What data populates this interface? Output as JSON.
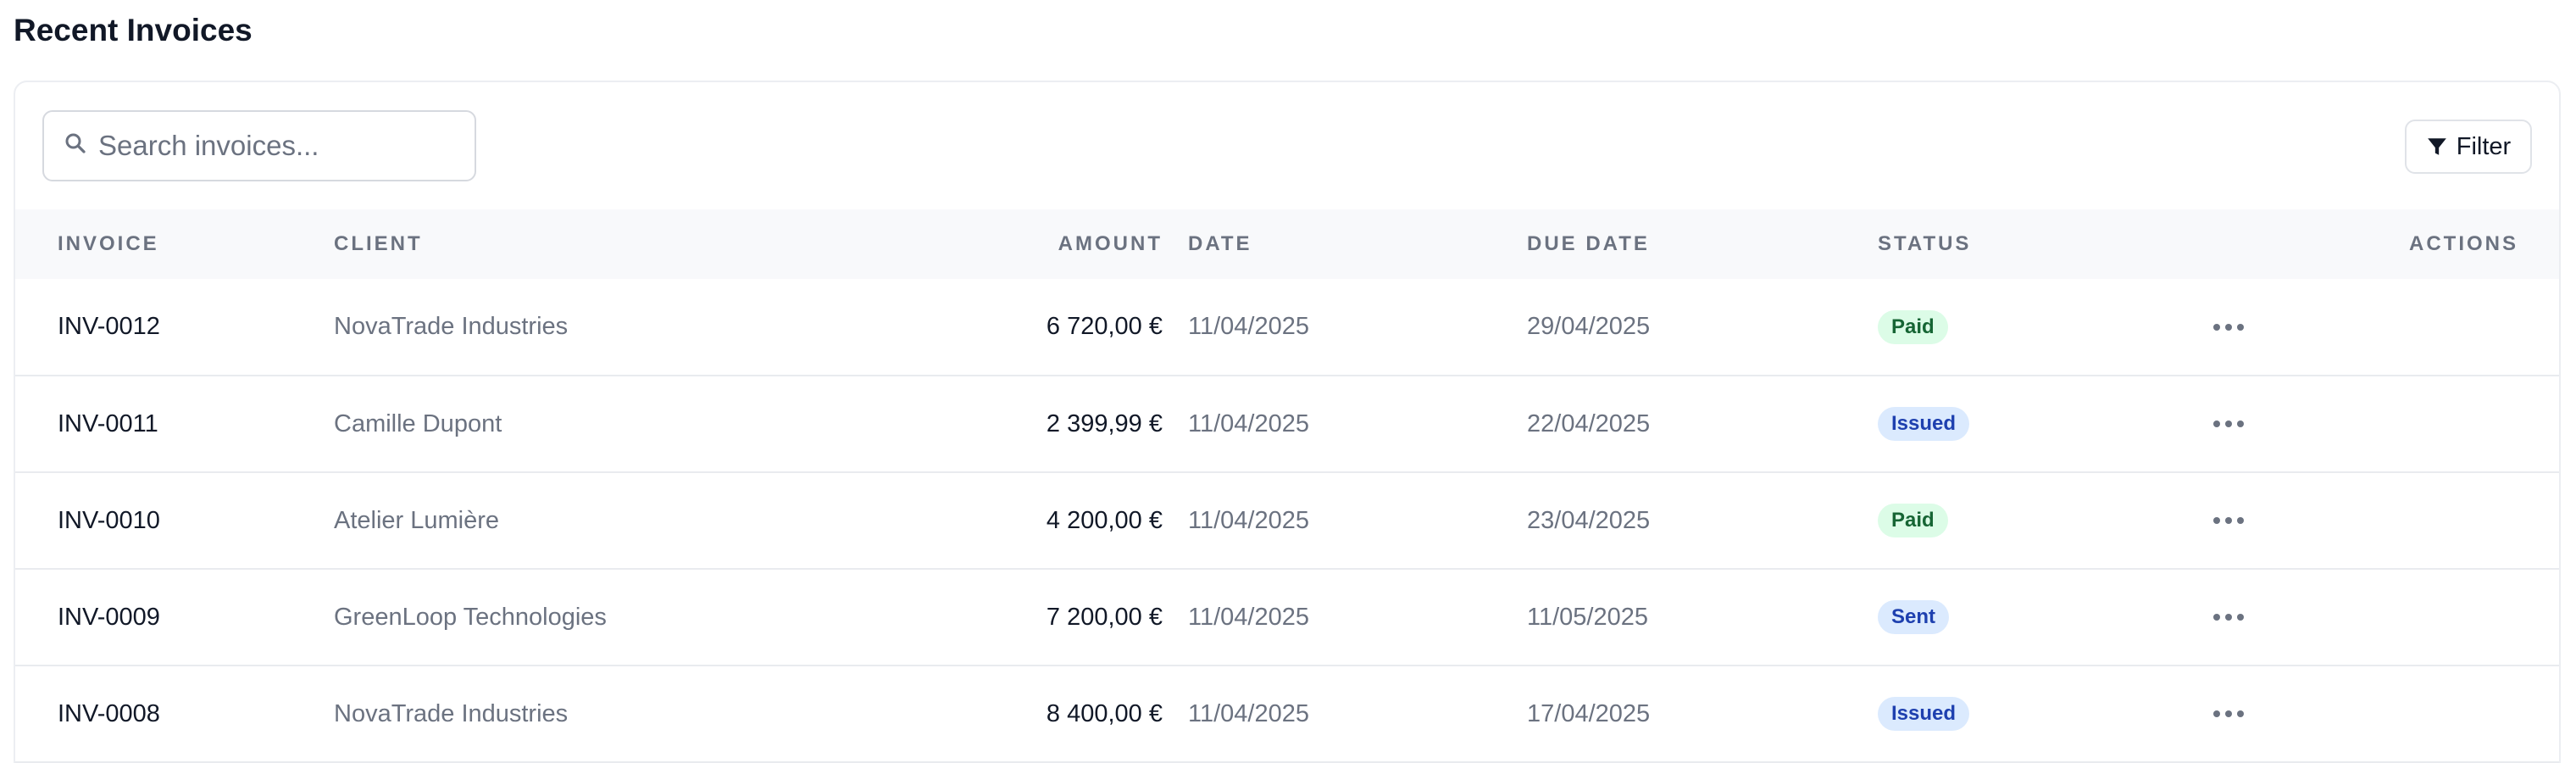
{
  "page": {
    "title": "Recent Invoices"
  },
  "search": {
    "placeholder": "Search invoices..."
  },
  "toolbar": {
    "filter_label": "Filter"
  },
  "table": {
    "columns": {
      "invoice": "INVOICE",
      "client": "CLIENT",
      "amount": "AMOUNT",
      "date": "DATE",
      "due_date": "DUE DATE",
      "status": "STATUS",
      "actions": "ACTIONS"
    },
    "rows": [
      {
        "invoice": "INV-0012",
        "client": "NovaTrade Industries",
        "amount": "6 720,00 €",
        "date": "11/04/2025",
        "due_date": "29/04/2025",
        "status": "Paid"
      },
      {
        "invoice": "INV-0011",
        "client": "Camille Dupont",
        "amount": "2 399,99 €",
        "date": "11/04/2025",
        "due_date": "22/04/2025",
        "status": "Issued"
      },
      {
        "invoice": "INV-0010",
        "client": "Atelier Lumière",
        "amount": "4 200,00 €",
        "date": "11/04/2025",
        "due_date": "23/04/2025",
        "status": "Paid"
      },
      {
        "invoice": "INV-0009",
        "client": "GreenLoop Technologies",
        "amount": "7 200,00 €",
        "date": "11/04/2025",
        "due_date": "11/05/2025",
        "status": "Sent"
      },
      {
        "invoice": "INV-0008",
        "client": "NovaTrade Industries",
        "amount": "8 400,00 €",
        "date": "11/04/2025",
        "due_date": "17/04/2025",
        "status": "Issued"
      }
    ]
  },
  "icons": {
    "search": "search-icon",
    "filter": "filter-icon",
    "more": "more-horizontal-icon"
  },
  "colors": {
    "paid_bg": "#dcfce7",
    "paid_text": "#166534",
    "issued_bg": "#dbeafe",
    "issued_text": "#1e40af",
    "header_bg": "#f8f9fb",
    "muted_text": "#6b7280"
  }
}
